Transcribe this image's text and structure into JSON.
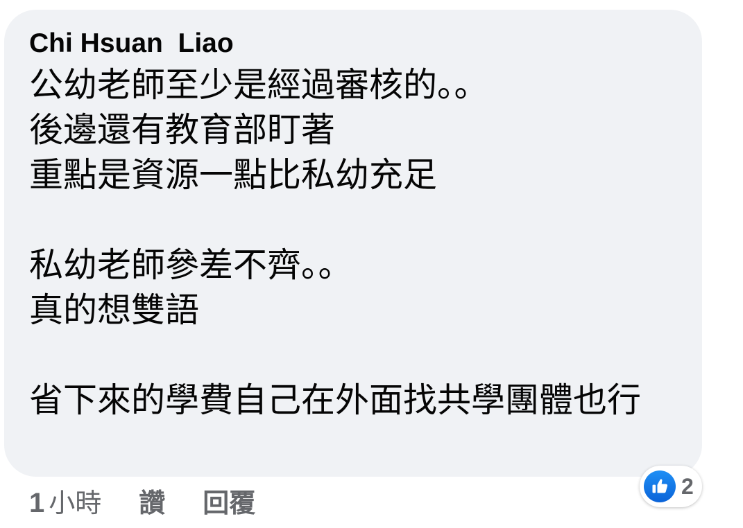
{
  "comment": {
    "author": "Chi Hsuan  Liao",
    "lines": [
      "公幼老師至少是經過審核的。。",
      "後邊還有教育部盯著",
      "重點是資源一點比私幼充足",
      "",
      "私幼老師參差不齊。。",
      "真的想雙語",
      "",
      "省下來的學費自己在外面找共學團體也行"
    ]
  },
  "reactions": {
    "icon": "like-icon",
    "count": "2",
    "accent": "#1877f2"
  },
  "actions": {
    "time_number": "1",
    "time_unit": "小時",
    "like_label": "讚",
    "reply_label": "回覆"
  }
}
